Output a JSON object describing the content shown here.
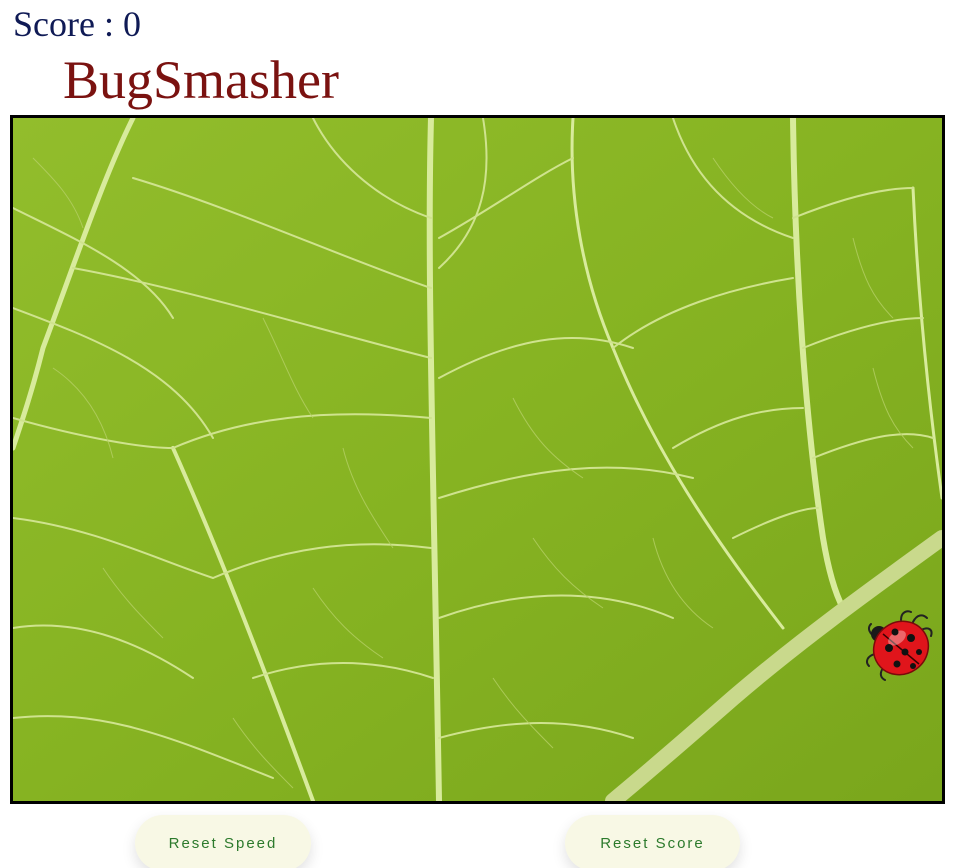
{
  "score": {
    "label": "Score : ",
    "value": "0"
  },
  "title": "BugSmasher",
  "game": {
    "background": "green-leaf-texture",
    "bug_icon": "ladybug-icon",
    "colors": {
      "leaf": "#86b526",
      "veins": "#d6ea98",
      "bug_shell": "#e0151b",
      "score_text": "#0f1a55",
      "title_text": "#7a1210"
    }
  },
  "buttons": {
    "reset_speed": "Reset Speed",
    "reset_score": "Reset Score"
  }
}
